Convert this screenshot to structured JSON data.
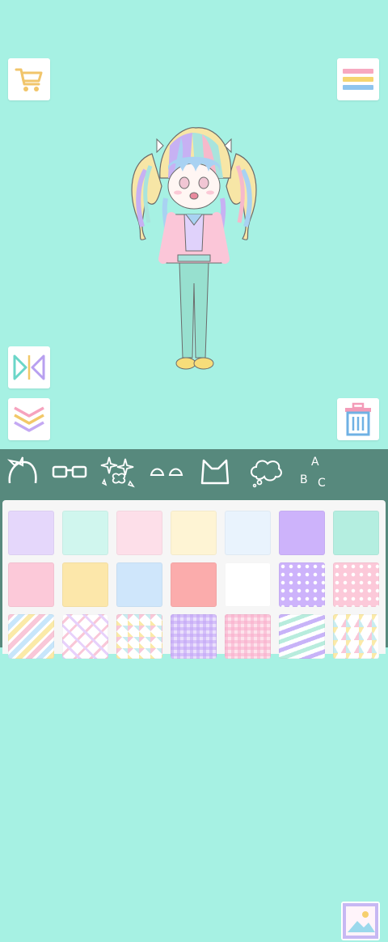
{
  "app": {
    "background_color": "#a6f1e3"
  },
  "buttons": {
    "shop": {
      "icon": "shopping-cart-icon"
    },
    "menu": {
      "icon": "hamburger-menu-icon"
    },
    "flip": {
      "icon": "flip-horizontal-icon"
    },
    "down": {
      "icon": "double-chevron-down-icon"
    },
    "trash": {
      "icon": "trash-can-icon"
    }
  },
  "toolbar": {
    "background": "#57897d",
    "tools": [
      {
        "icon": "hair-accessory-icon"
      },
      {
        "icon": "glasses-icon"
      },
      {
        "icon": "sparkles-effects-icon"
      },
      {
        "icon": "eyebrows-icon"
      },
      {
        "icon": "cat-ears-icon"
      },
      {
        "icon": "speech-bubble-icon"
      },
      {
        "icon": "text-abc-icon",
        "letters": [
          "A",
          "B",
          "C"
        ]
      },
      {
        "icon": "background-image-icon",
        "selected": true
      }
    ]
  },
  "palette": {
    "rows": [
      [
        "#e5d7fb",
        "#d0f6ee",
        "#fddfe9",
        "#fef4d4",
        "#e9f3fd",
        "#cdb3fb",
        "#b4eee0"
      ],
      [
        "#fcc9d9",
        "#fce7aa",
        "#cfe6fb",
        "#fbacac",
        "#ffffff",
        "purple-dots-pattern",
        "pink-dots-pattern"
      ],
      [
        "pastel-stripes-pattern",
        "lattice-pattern",
        "triangle-pattern",
        "lavender-gingham-pattern",
        "pink-gingham-pattern",
        "wavy-chevron-pattern",
        "rainbow-triangle-pattern"
      ]
    ]
  }
}
